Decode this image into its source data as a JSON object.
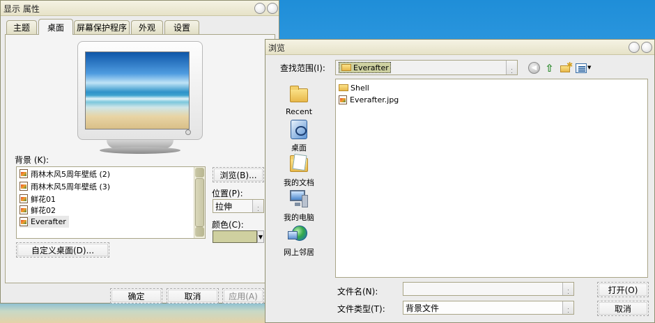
{
  "display_props": {
    "title": "显示 属性",
    "tabs": [
      {
        "label": "主题"
      },
      {
        "label": "桌面"
      },
      {
        "label": "屏幕保护程序"
      },
      {
        "label": "外观"
      },
      {
        "label": "设置"
      }
    ],
    "background_label": "背景 (K):",
    "background_items": [
      {
        "label": "雨林木风5周年壁纸 (2)"
      },
      {
        "label": "雨林木风5周年壁纸 (3)"
      },
      {
        "label": "鲜花01"
      },
      {
        "label": "鲜花02"
      },
      {
        "label": "Everafter"
      }
    ],
    "browse_button": "浏览(B)...",
    "position_label": "位置(P):",
    "position_value": "拉伸",
    "color_label": "颜色(C):",
    "color_swatch": "#cfd0a0",
    "customize_button": "自定义桌面(D)...",
    "ok_button": "确定",
    "cancel_button": "取消",
    "apply_button": "应用(A)"
  },
  "browse_dialog": {
    "title": "浏览",
    "look_in_label": "查找范围(I):",
    "look_in_value": "Everafter",
    "places": [
      {
        "label": "Recent",
        "icon": "recent-folder-icon"
      },
      {
        "label": "桌面",
        "icon": "desktop-icon"
      },
      {
        "label": "我的文档",
        "icon": "my-documents-icon"
      },
      {
        "label": "我的电脑",
        "icon": "my-computer-icon"
      },
      {
        "label": "网上邻居",
        "icon": "network-places-icon"
      }
    ],
    "files": [
      {
        "name": "Shell",
        "type": "folder"
      },
      {
        "name": "Everafter.jpg",
        "type": "image"
      }
    ],
    "filename_label": "文件名(N):",
    "filename_value": "",
    "filetype_label": "文件类型(T):",
    "filetype_value": "背景文件",
    "open_button": "打开(O)",
    "cancel_button": "取消"
  }
}
